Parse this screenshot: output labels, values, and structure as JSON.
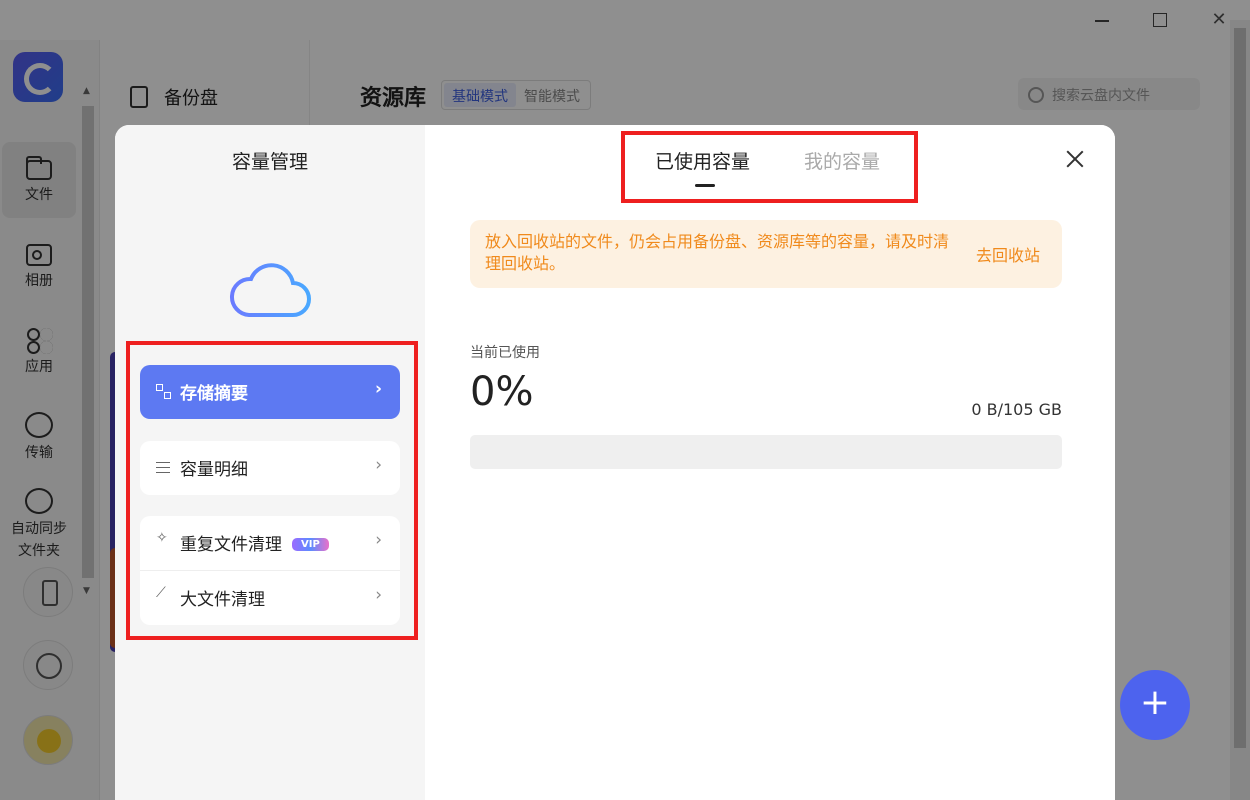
{
  "window": {
    "close_glyph": "✕"
  },
  "rail": {
    "items": [
      {
        "label": "文件",
        "icon": "folder-icon"
      },
      {
        "label": "相册",
        "icon": "photo-icon"
      },
      {
        "label": "应用",
        "icon": "apps-icon"
      },
      {
        "label": "传输",
        "icon": "transfer-icon"
      },
      {
        "label": "自动同步\n文件夹",
        "line1": "自动同步",
        "line2": "文件夹",
        "icon": "sync-icon"
      }
    ]
  },
  "folder_pane": {
    "backup_label": "备份盘"
  },
  "header": {
    "title": "资源库",
    "mode_basic": "基础模式",
    "mode_smart": "智能模式",
    "search_placeholder": "搜索云盘内文件"
  },
  "fab": {
    "label": "+"
  },
  "modal": {
    "title": "容量管理",
    "menu": {
      "summary": "存储摘要",
      "detail": "容量明细",
      "dup_clean": "重复文件清理",
      "vip_badge": "VIP",
      "big_clean": "大文件清理",
      "chevron": "›"
    },
    "tabs": {
      "used": "已使用容量",
      "mine": "我的容量"
    },
    "notice": {
      "text": "放入回收站的文件，仍会占用备份盘、资源库等的容量，请及时清理回收站。",
      "link": "去回收站"
    },
    "usage": {
      "label": "当前已使用",
      "percent": "0%",
      "amount": "0 B/105 GB",
      "fraction": 0
    }
  },
  "colors": {
    "accent": "#5d79f2",
    "warning": "#f08a1c",
    "annotation": "#ee1f1f"
  }
}
